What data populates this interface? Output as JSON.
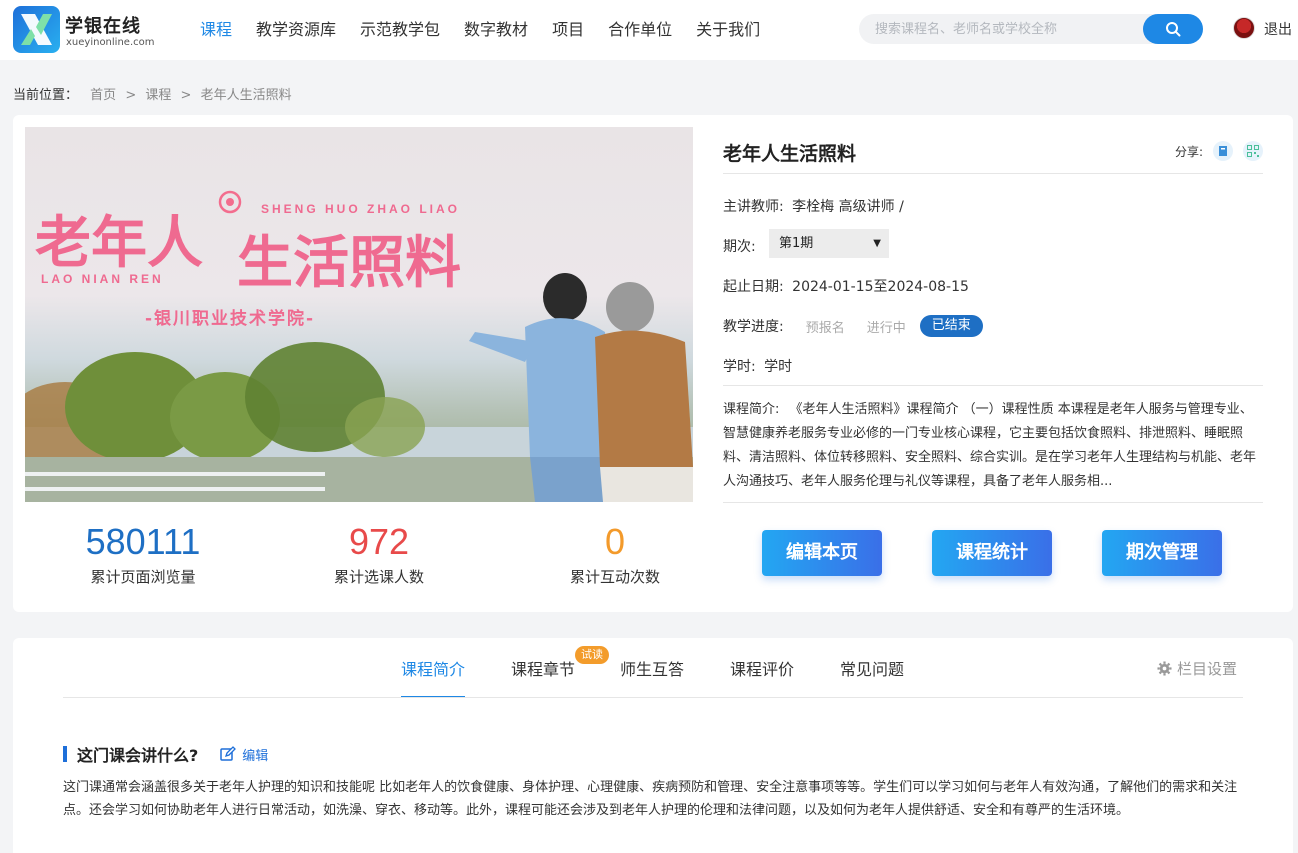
{
  "header": {
    "brand_cn": "学银在线",
    "brand_en": "xueyinonline.com",
    "nav": [
      "课程",
      "教学资源库",
      "示范教学包",
      "数字教材",
      "项目",
      "合作单位",
      "关于我们"
    ],
    "search_placeholder": "搜索课程名、老师名或学校全称",
    "logout": "退出"
  },
  "breadcrumb": {
    "label": "当前位置：",
    "home": "首页",
    "sep1": ">",
    "courses": "课程",
    "sep2": ">",
    "current": "老年人生活照料"
  },
  "cover": {
    "title_left": "老年人",
    "title_right": "生活照料",
    "pinyin_right": "SHENG HUO ZHAO LIAO",
    "pinyin_left": "LAO NIAN REN",
    "school": "-银川职业技术学院-"
  },
  "stats": [
    {
      "value": "580111",
      "label": "累计页面浏览量",
      "color": "#1e6fc4"
    },
    {
      "value": "972",
      "label": "累计选课人数",
      "color": "#e84a4a"
    },
    {
      "value": "0",
      "label": "累计互动次数",
      "color": "#f39a2b"
    }
  ],
  "course": {
    "title": "老年人生活照料",
    "share_label": "分享:",
    "teacher_label": "主讲教师:",
    "teacher": "李栓梅 高级讲师 /",
    "term_label": "期次:",
    "term_value": "第1期",
    "date_label": "起止日期:",
    "dates": "2024-01-15至2024-08-15",
    "progress_label": "教学进度:",
    "steps": [
      "预报名",
      "进行中",
      "已结束"
    ],
    "hours_label": "学时:",
    "hours": "学时",
    "summary_label": "课程简介:",
    "summary": "《老年人生活照料》课程简介 （一）课程性质 本课程是老年人服务与管理专业、智慧健康养老服务专业必修的一门专业核心课程，它主要包括饮食照料、排泄照料、睡眠照料、清洁照料、体位转移照料、安全照料、综合实训。是在学习老年人生理结构与机能、老年人沟通技巧、老年人服务伦理与礼仪等课程，具备了老年人服务相..."
  },
  "buttons": {
    "edit": "编辑本页",
    "stats": "课程统计",
    "terms": "期次管理"
  },
  "tabs": {
    "items": [
      "课程简介",
      "课程章节",
      "师生互答",
      "课程评价",
      "常见问题"
    ],
    "badge": "试读",
    "settings": "栏目设置"
  },
  "section": {
    "title": "这门课会讲什么?",
    "edit": "编辑",
    "text": "这门课通常会涵盖很多关于老年人护理的知识和技能呢 比如老年人的饮食健康、身体护理、心理健康、疾病预防和管理、安全注意事项等等。学生们可以学习如何与老年人有效沟通，了解他们的需求和关注点。还会学习如何协助老年人进行日常活动，如洗澡、穿衣、移动等。此外，课程可能还会涉及到老年人护理的伦理和法律问题，以及如何为老年人提供舒适、安全和有尊严的生活环境。"
  }
}
